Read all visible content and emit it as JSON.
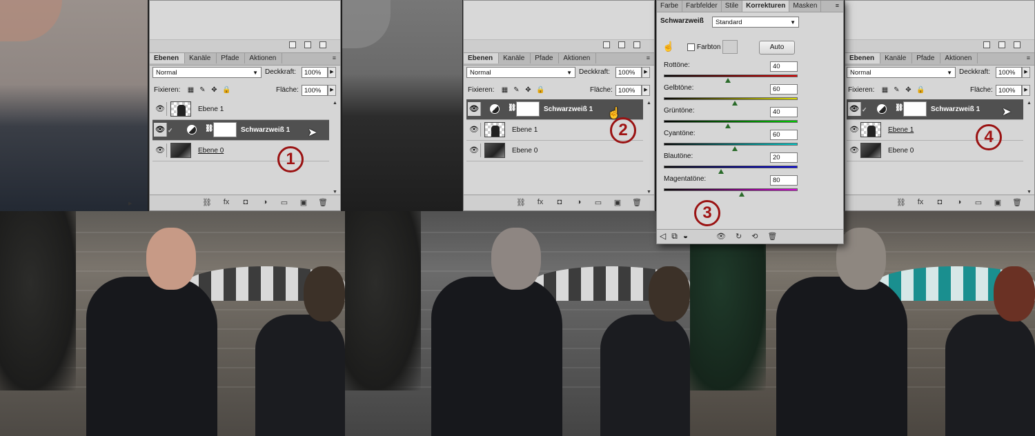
{
  "panels": {
    "tabs": [
      "Ebenen",
      "Kanäle",
      "Pfade",
      "Aktionen"
    ],
    "menu_icon": "≡",
    "blend_mode": "Normal",
    "opacity_label": "Deckkraft:",
    "opacity_value": "100%",
    "lock_label": "Fixieren:",
    "fill_label": "Fläche:",
    "fill_value": "100%"
  },
  "panel1": {
    "layers": [
      "Ebene 1",
      "Schwarzweiß 1",
      "Ebene 0"
    ],
    "badge": "1"
  },
  "panel2": {
    "layers": [
      "Schwarzweiß 1",
      "Ebene 1",
      "Ebene 0"
    ],
    "badge": "2"
  },
  "panel4": {
    "layers": [
      "Schwarzweiß 1",
      "Ebene 1",
      "Ebene 0"
    ],
    "badge": "4"
  },
  "adjustments": {
    "tabs": [
      "Farbe",
      "Farbfelder",
      "Stile",
      "Korrekturen",
      "Masken"
    ],
    "title": "Schwarzweiß",
    "preset": "Standard",
    "tint_label": "Farbton",
    "auto_label": "Auto",
    "sliders": [
      {
        "label": "Rottöne:",
        "value": "40",
        "pos": 0.48,
        "gradient": "linear-gradient(90deg,#000,#d00)"
      },
      {
        "label": "Gelbtöne:",
        "value": "60",
        "pos": 0.53,
        "gradient": "linear-gradient(90deg,#000,#dd0)"
      },
      {
        "label": "Grüntöne:",
        "value": "40",
        "pos": 0.48,
        "gradient": "linear-gradient(90deg,#000,#0c0)"
      },
      {
        "label": "Cyantöne:",
        "value": "60",
        "pos": 0.53,
        "gradient": "linear-gradient(90deg,#000,#0cc)"
      },
      {
        "label": "Blautöne:",
        "value": "20",
        "pos": 0.43,
        "gradient": "linear-gradient(90deg,#000,#00d)"
      },
      {
        "label": "Magentatöne:",
        "value": "80",
        "pos": 0.58,
        "gradient": "linear-gradient(90deg,#000,#d0d)"
      }
    ],
    "badge": "3"
  },
  "colors": {
    "badge": "#9a1212",
    "selected_layer": "#505050",
    "panel_bg": "#d6d6d6"
  }
}
